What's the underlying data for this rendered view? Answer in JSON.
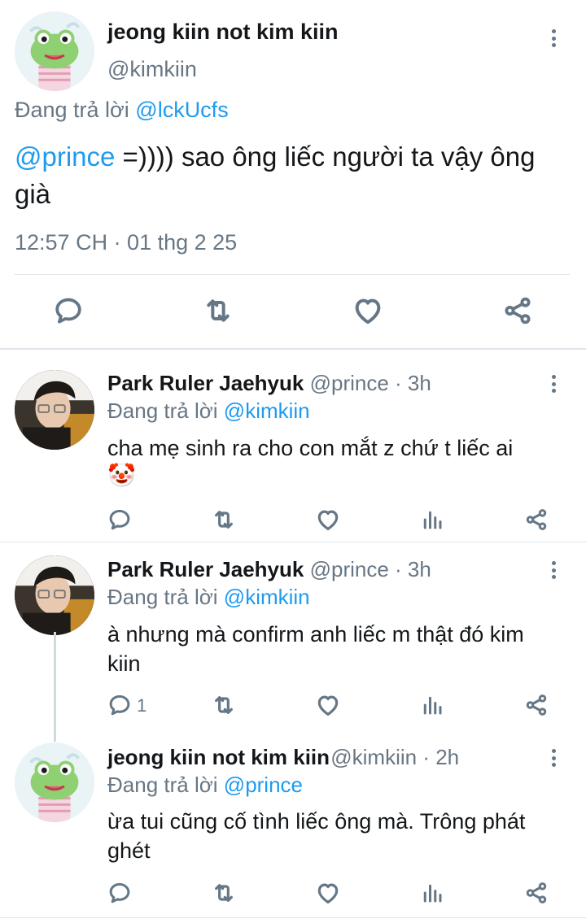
{
  "main_tweet": {
    "display_name": "jeong kiin not kim kiin",
    "handle": "@kimkiin",
    "replying_prefix": "Đang trả lời",
    "replying_to": "@lckUcfs",
    "text_mention": "@prince",
    "text_body": " =)))) sao ông liếc người ta vậy ông già",
    "timestamp": "12:57 CH · 01 thg 2 25"
  },
  "replies": [
    {
      "display_name": "Park Ruler Jaehyuk",
      "handle_time": "@prince · 3h",
      "replying_prefix": "Đang trả lời",
      "replying_to": "@kimkiin",
      "text": "cha mẹ sinh ra cho con mắt z chứ t liếc ai",
      "emoji": "🤡",
      "reply_count": ""
    },
    {
      "display_name": "Park Ruler Jaehyuk",
      "handle_time": "@prince · 3h",
      "replying_prefix": "Đang trả lời",
      "replying_to": "@kimkiin",
      "text": "à nhưng mà confirm anh liếc m thật đó kim kiin",
      "reply_count": "1"
    },
    {
      "display_name": "jeong kiin not kim kiin",
      "handle_time": "@kimkiin · 2h",
      "replying_prefix": "Đang trả lời",
      "replying_to": "@prince",
      "text": "ừa tui cũng cố tình liếc ông mà. Trông phát ghét",
      "reply_count": ""
    }
  ],
  "icons": [
    "reply-icon",
    "retweet-icon",
    "like-icon",
    "analytics-icon",
    "share-icon",
    "more-icon"
  ],
  "colors": {
    "link": "#1d9bf0",
    "muted": "#687684",
    "icon": "#657786"
  }
}
